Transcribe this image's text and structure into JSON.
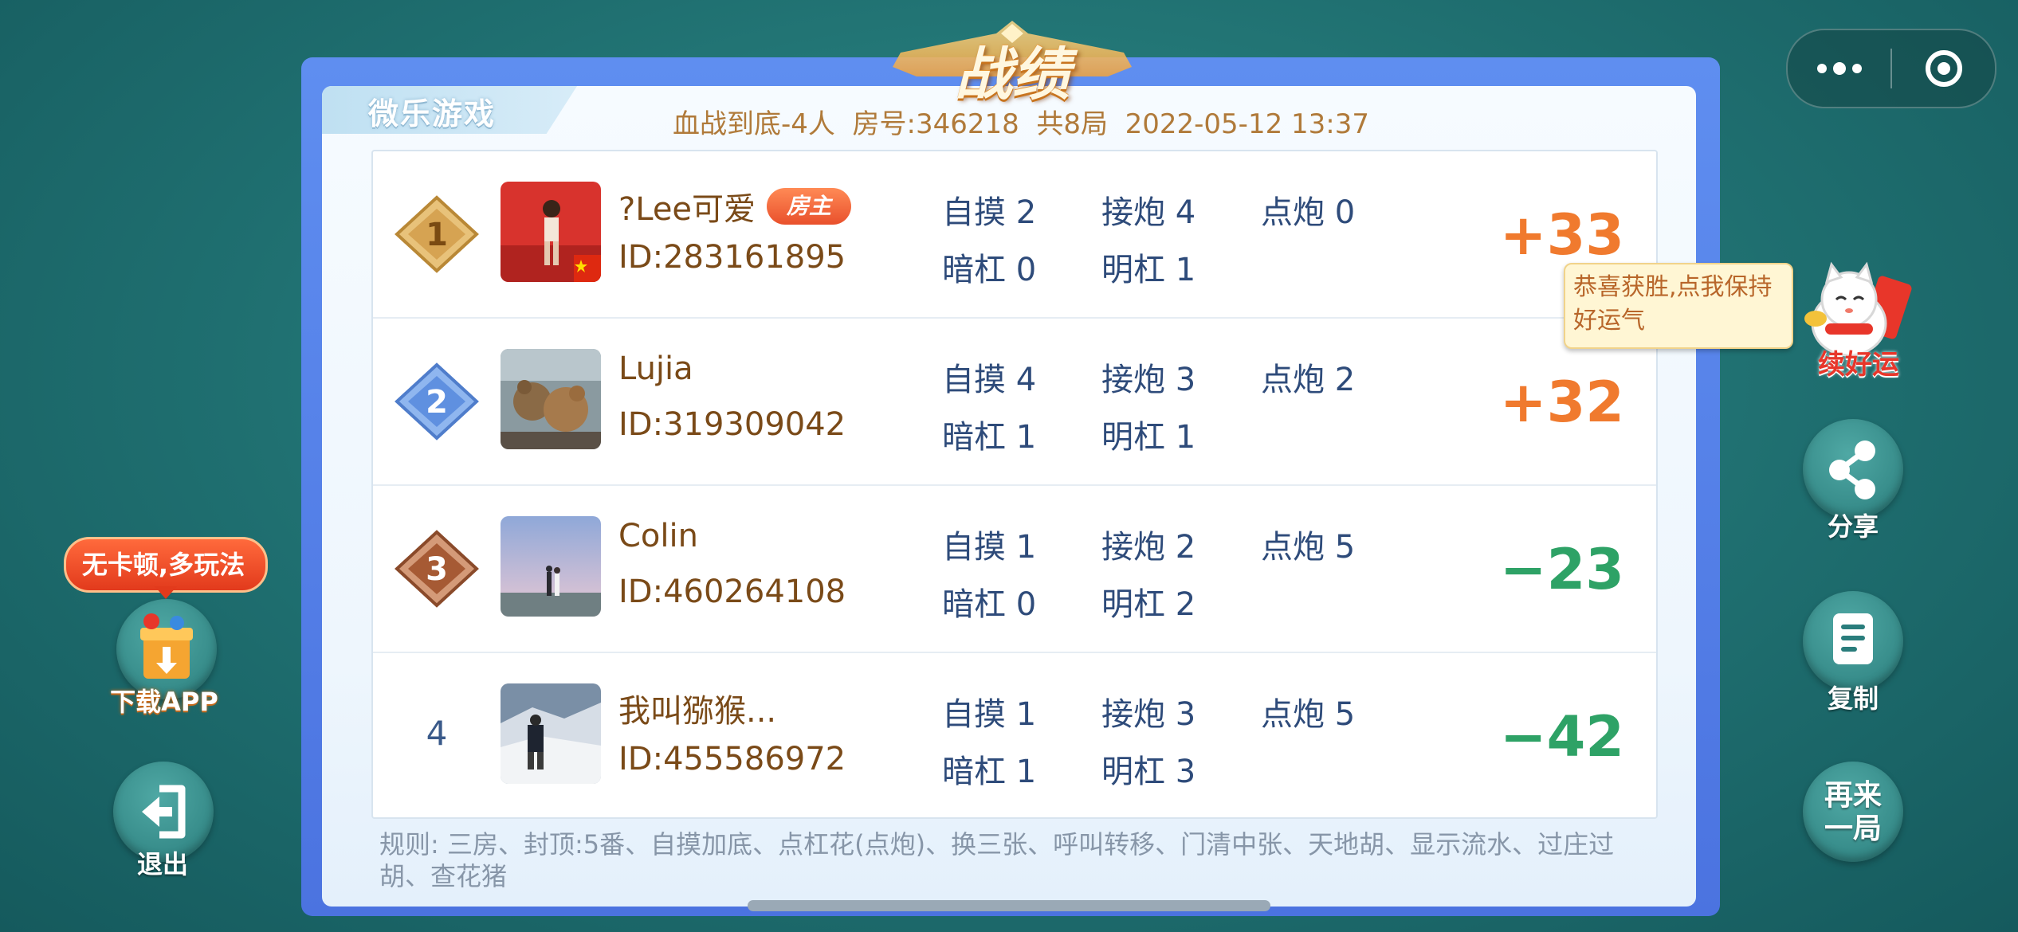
{
  "title": "战绩",
  "brand": "微乐游戏",
  "game_info": "血战到底-4人  房号:346218  共8局  2022-05-12 13:37",
  "players": [
    {
      "rank": "1",
      "name": "?Lee可爱",
      "host_badge": "房主",
      "id": "ID:283161895",
      "zimo": "自摸 2",
      "jiepao": "接炮 4",
      "dianpao": "点炮 0",
      "angang": "暗杠 0",
      "minggang": "明杠 1",
      "score": "+33"
    },
    {
      "rank": "2",
      "name": "Lujia",
      "id": "ID:319309042",
      "zimo": "自摸 4",
      "jiepao": "接炮 3",
      "dianpao": "点炮 2",
      "angang": "暗杠 1",
      "minggang": "明杠 1",
      "score": "+32"
    },
    {
      "rank": "3",
      "name": "Colin",
      "id": "ID:460264108",
      "zimo": "自摸 1",
      "jiepao": "接炮 2",
      "dianpao": "点炮 5",
      "angang": "暗杠 0",
      "minggang": "明杠 2",
      "score": "−23"
    },
    {
      "rank": "4",
      "name": "我叫猕猴...",
      "id": "ID:455586972",
      "zimo": "自摸 1",
      "jiepao": "接炮 3",
      "dianpao": "点炮 5",
      "angang": "暗杠 1",
      "minggang": "明杠 3",
      "score": "−42"
    }
  ],
  "rules": "规则: 三房、封顶:5番、自摸加底、点杠花(点炮)、换三张、呼叫转移、门清中张、天地胡、显示流水、过庄过胡、查花猪",
  "tooltip": "恭喜获胜,点我保持好运气",
  "lucky_label": "续好运",
  "side_buttons": {
    "share": "分享",
    "copy": "复制",
    "again": "再来一局"
  },
  "left": {
    "promo": "无卡顿,多玩法",
    "download": "下载APP",
    "exit": "退出"
  },
  "colors": {
    "positive": "#f07a2e",
    "negative": "#2ea266",
    "name": "#7a4a18",
    "stat": "#2e4b7a"
  }
}
